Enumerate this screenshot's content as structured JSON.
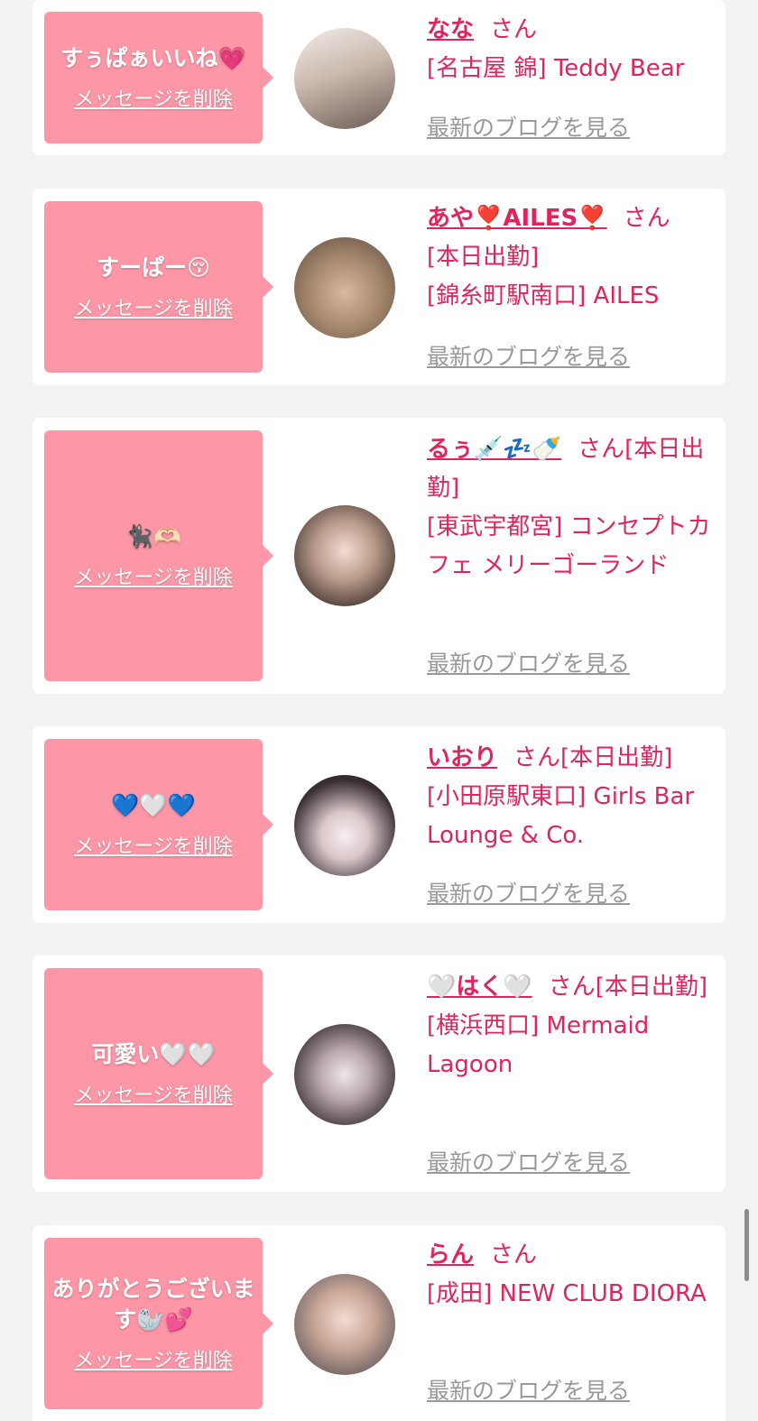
{
  "delete_label": "メッセージを削除",
  "blog_label": "最新のブログを見る",
  "san_label": "さん",
  "colors": {
    "bubble": "#fd96a6",
    "accent": "#e0245e",
    "muted": "#999999",
    "background": "#f3f3f3"
  },
  "cards": [
    {
      "message": "すぅぱぁいいね💗",
      "name": "なな",
      "status": "",
      "shop_lines": [
        "[名古屋 錦] Teddy Bear"
      ],
      "avatar_icon": "avatar-photo"
    },
    {
      "message": "すーぱー😚",
      "name": "あや❣️AILES❣️",
      "status": "",
      "shop_lines": [
        "[本日出勤]",
        "[錦糸町駅南口] AILES"
      ],
      "avatar_icon": "avatar-photo"
    },
    {
      "message": "🐈‍⬛🫶🏻",
      "name": "るぅ💉💤🍼",
      "status": "[本日出勤]",
      "shop_lines": [
        "[東武宇都宮] コンセプトカフェ メリーゴーランド"
      ],
      "avatar_icon": "avatar-photo"
    },
    {
      "message": "💙🤍💙",
      "name": "いおり",
      "status": "[本日出勤]",
      "shop_lines": [
        "[小田原駅東口] Girls Bar Lounge & Co."
      ],
      "avatar_icon": "avatar-photo"
    },
    {
      "message": "可愛い🤍🤍",
      "name": "🤍はく🤍",
      "status": "[本日出勤]",
      "shop_lines": [
        "[横浜西口] Mermaid Lagoon"
      ],
      "avatar_icon": "avatar-photo"
    },
    {
      "message": "ありがとうございます🦭💕",
      "name": "らん",
      "status": "",
      "shop_lines": [
        "[成田] NEW CLUB DIORA"
      ],
      "avatar_icon": "avatar-photo"
    }
  ]
}
